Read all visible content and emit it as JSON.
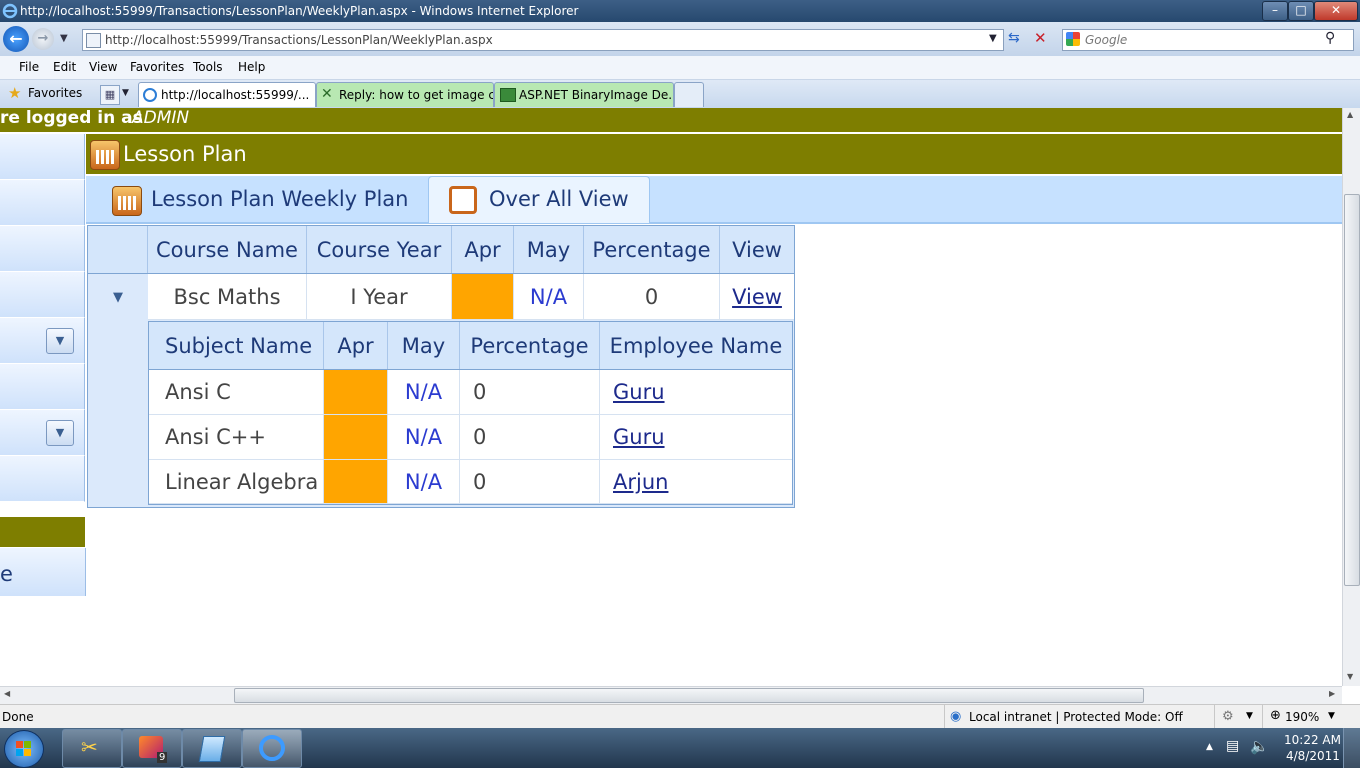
{
  "window": {
    "title": "http://localhost:55999/Transactions/LessonPlan/WeeklyPlan.aspx - Windows Internet Explorer",
    "minimize": "–",
    "maximize": "□",
    "close": "✕"
  },
  "address": {
    "url": "http://localhost:55999/Transactions/LessonPlan/WeeklyPlan.aspx",
    "search_placeholder": "Google"
  },
  "menu": [
    "File",
    "Edit",
    "View",
    "Favorites",
    "Tools",
    "Help"
  ],
  "favorites_label": "Favorites",
  "browser_tabs": [
    {
      "label": "http://localhost:55999/...",
      "active": true
    },
    {
      "label": "Reply: how to get image c...",
      "active": false
    },
    {
      "label": "ASP.NET BinaryImage De...",
      "active": false
    }
  ],
  "page": {
    "user_bar": "re logged in as ",
    "user_name": "ADMIN",
    "header_title": "Lesson Plan",
    "sidebar_partial_text": "e",
    "tabs": [
      {
        "label": "Lesson Plan Weekly Plan"
      },
      {
        "label": "Over All View",
        "selected": true
      }
    ]
  },
  "course_grid": {
    "headers": [
      "Course Name",
      "Course Year",
      "Apr",
      "May",
      "Percentage",
      "View"
    ],
    "row": {
      "course_name": "Bsc Maths",
      "course_year": "I Year",
      "apr": "",
      "may": "N/A",
      "percentage": "0",
      "view": "View"
    }
  },
  "subject_grid": {
    "headers": [
      "Subject Name",
      "Apr",
      "May",
      "Percentage",
      "Employee Name"
    ],
    "rows": [
      {
        "subject": "Ansi C",
        "apr": "",
        "may": "N/A",
        "percentage": "0",
        "employee": "Guru"
      },
      {
        "subject": "Ansi C++",
        "apr": "",
        "may": "N/A",
        "percentage": "0",
        "employee": "Guru"
      },
      {
        "subject": "Linear Algebra",
        "apr": "",
        "may": "N/A",
        "percentage": "0",
        "employee": "Arjun"
      }
    ]
  },
  "status": {
    "left": "Done",
    "zone": "Local intranet | Protected Mode: Off",
    "zoom": "190%"
  },
  "taskbar": {
    "time": "10:22 AM",
    "date": "4/8/2011",
    "badge": "9"
  },
  "colors": {
    "olive_bar": "#7e7e00",
    "tab_strip": "#c6e1ff",
    "apr_fill": "#ffa500"
  }
}
